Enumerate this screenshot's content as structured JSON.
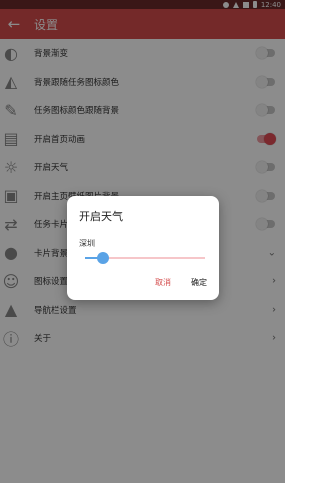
{
  "status_bar": {
    "time": "12:40"
  },
  "app_bar": {
    "title": "设置",
    "back_icon": "arrow-left-icon"
  },
  "settings": [
    {
      "label": "背景渐变",
      "icon": "half-drop-icon",
      "control": "toggle",
      "on": false
    },
    {
      "label": "背景跟随任务图标颜色",
      "icon": "paint-bucket-icon",
      "control": "toggle",
      "on": false
    },
    {
      "label": "任务图标颜色跟随背景",
      "icon": "paint-brush-icon",
      "control": "toggle",
      "on": false
    },
    {
      "label": "开启首页动画",
      "icon": "folder-icon",
      "control": "toggle",
      "on": true
    },
    {
      "label": "开启天气",
      "icon": "sun-icon",
      "control": "toggle",
      "on": false
    },
    {
      "label": "开启主页壁纸图片背景",
      "icon": "image-icon",
      "control": "toggle",
      "on": false
    },
    {
      "label": "任务卡片",
      "icon": "repeat-icon",
      "control": "toggle",
      "on": false
    },
    {
      "label": "卡片背景",
      "icon": "droplet-icon",
      "control": "chevron"
    },
    {
      "label": "图标设置",
      "icon": "smiley-icon",
      "control": "chevron"
    },
    {
      "label": "导航栏设置",
      "icon": "navigation-icon",
      "control": "chevron"
    },
    {
      "label": "关于",
      "icon": "info-icon",
      "control": "chevron"
    }
  ],
  "dialog": {
    "title": "开启天气",
    "city": "深圳",
    "slider_fraction": 0.15,
    "cancel_label": "取消",
    "ok_label": "确定"
  },
  "colors": {
    "accent": "#d44c4c",
    "slider": "#5aa3e6",
    "toggle_on": "#e14b55"
  }
}
